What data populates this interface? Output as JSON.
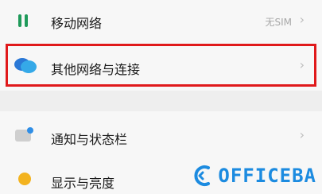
{
  "settings": {
    "items": [
      {
        "label": "移动网络",
        "value": "无SIM",
        "icon": "signal-bars-icon"
      },
      {
        "label": "其他网络与连接",
        "value": "",
        "icon": "chat-bubbles-icon"
      },
      {
        "label": "通知与状态栏",
        "value": "",
        "icon": "notification-box-icon"
      },
      {
        "label": "显示与亮度",
        "value": "",
        "icon": "sun-dot-icon"
      }
    ],
    "chevron": "›"
  },
  "highlight": {
    "color": "#e0191b"
  },
  "watermark": {
    "text": "OFFICEBA",
    "color": "#1c8be0",
    "logo_icon": "c-logo-icon"
  },
  "colors": {
    "background": "#f7f7f7",
    "signal_icon": "#1f9a5a",
    "bubble_icon": "#2a78d6",
    "notify_icon": "#c9c9c9",
    "sun_icon": "#f3b31f"
  }
}
